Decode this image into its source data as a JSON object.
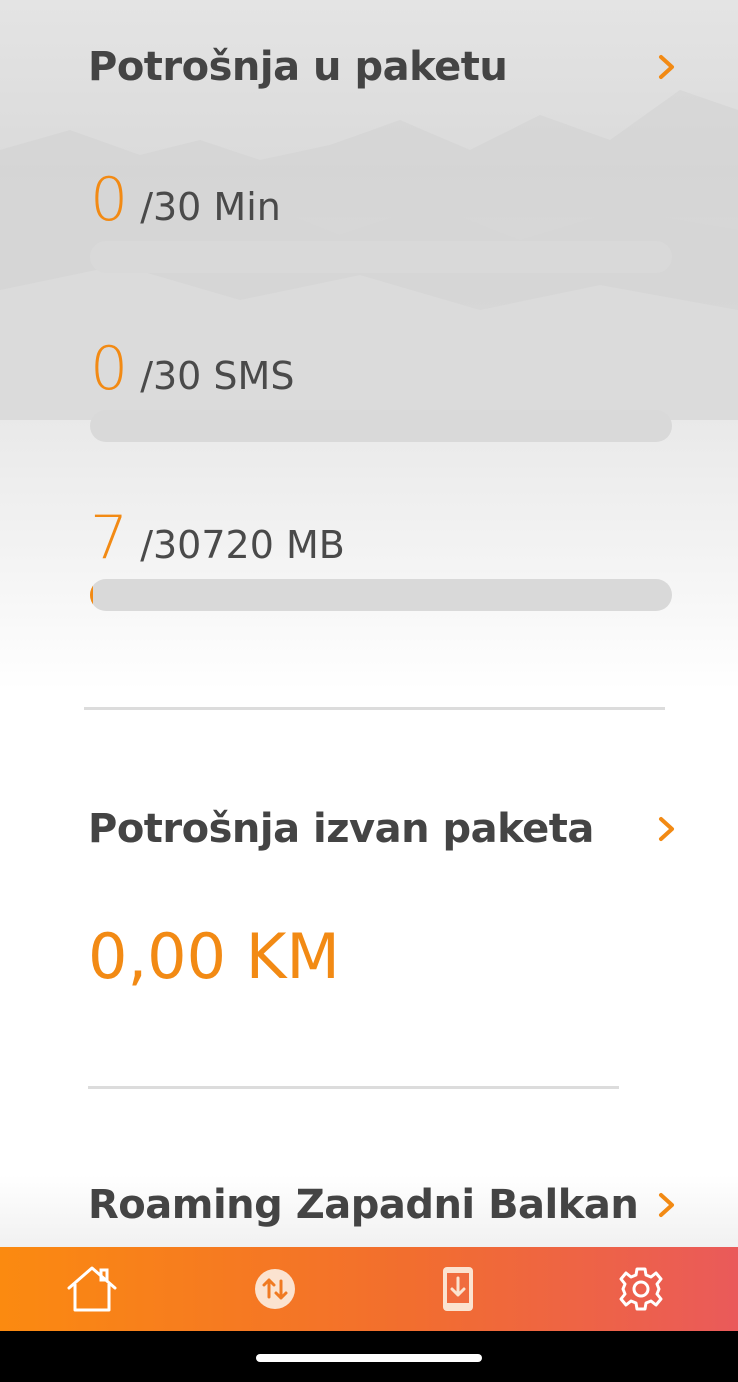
{
  "package_usage": {
    "title": "Potrošnja u paketu",
    "items": [
      {
        "used": "0",
        "limit": "/30 Min",
        "fraction": 0
      },
      {
        "used": "0",
        "limit": "/30 SMS",
        "fraction": 0
      },
      {
        "used": "7",
        "limit": "/30720 MB",
        "fraction": 0.0002
      }
    ]
  },
  "out_of_package": {
    "title": "Potrošnja izvan paketa",
    "amount": "0,00 KM"
  },
  "roaming": {
    "title": "Roaming Zapadni Balkan"
  },
  "bottom_nav": {
    "items": [
      {
        "icon": "home-icon"
      },
      {
        "icon": "transfer-icon"
      },
      {
        "icon": "phone-download-icon"
      },
      {
        "icon": "settings-gear-icon"
      }
    ]
  },
  "colors": {
    "accent": "#f28a14",
    "title": "#444444",
    "bar_track": "#d9d9d9",
    "nav_start": "#fb8a10",
    "nav_end": "#ea5a5a"
  }
}
